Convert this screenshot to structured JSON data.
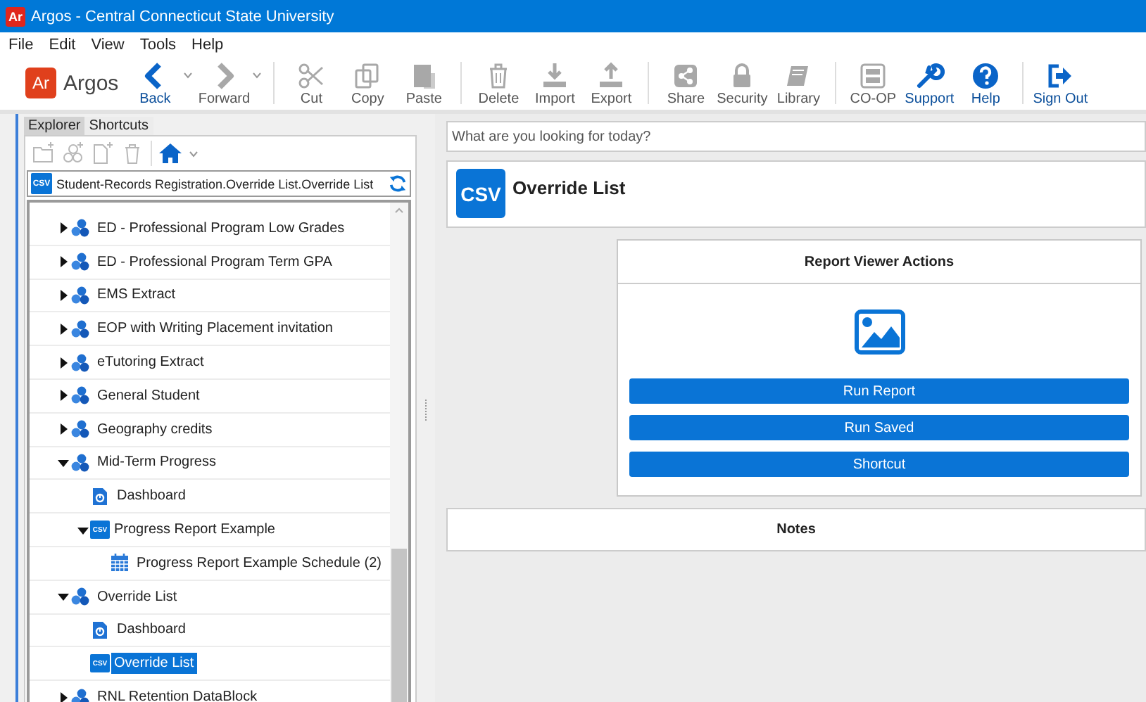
{
  "window": {
    "title": "Argos - Central Connecticut State University",
    "app_icon": "Ar"
  },
  "menu": [
    "File",
    "Edit",
    "View",
    "Tools",
    "Help"
  ],
  "toolbar": {
    "logo_badge": "Ar",
    "logo_text": "Argos",
    "groups": [
      [
        {
          "label": "Back",
          "disabled": false,
          "has_menu": true
        },
        {
          "label": "Forward",
          "disabled": true,
          "has_menu": true
        }
      ],
      [
        {
          "label": "Cut",
          "disabled": true,
          "has_menu": false
        },
        {
          "label": "Copy",
          "disabled": true,
          "has_menu": false
        },
        {
          "label": "Paste",
          "disabled": true,
          "has_menu": false
        }
      ],
      [
        {
          "label": "Delete",
          "disabled": true,
          "has_menu": false
        },
        {
          "label": "Import",
          "disabled": true,
          "has_menu": false
        },
        {
          "label": "Export",
          "disabled": true,
          "has_menu": false
        }
      ],
      [
        {
          "label": "Share",
          "disabled": true,
          "has_menu": false
        },
        {
          "label": "Security",
          "disabled": true,
          "has_menu": false
        },
        {
          "label": "Library",
          "disabled": true,
          "has_menu": false
        }
      ],
      [
        {
          "label": "CO-OP",
          "disabled": true,
          "has_menu": false
        },
        {
          "label": "Support",
          "disabled": false,
          "has_menu": false
        },
        {
          "label": "Help",
          "disabled": false,
          "has_menu": false
        }
      ],
      [
        {
          "label": "Sign Out",
          "disabled": false,
          "has_menu": false
        }
      ]
    ]
  },
  "explorer": {
    "tabs": [
      {
        "label": "Explorer",
        "selected": true
      },
      {
        "label": "Shortcuts",
        "selected": false
      }
    ],
    "tools": [
      {
        "disabled": true
      },
      {
        "disabled": true
      },
      {
        "disabled": true
      },
      {
        "disabled": true
      },
      {
        "disabled": false
      }
    ],
    "path": {
      "badge": "CSV",
      "text": "Student-Records Registration.Override List.Override List"
    },
    "tree": [
      {
        "label": "ED - Professional Program Low Grades",
        "kind": "datablock",
        "expanded": false,
        "selected": false
      },
      {
        "label": "ED - Professional Program Term GPA",
        "kind": "datablock",
        "expanded": false,
        "selected": false
      },
      {
        "label": "EMS Extract",
        "kind": "datablock",
        "expanded": false,
        "selected": false
      },
      {
        "label": "EOP with Writing Placement invitation",
        "kind": "datablock",
        "expanded": false,
        "selected": false
      },
      {
        "label": "eTutoring Extract",
        "kind": "datablock",
        "expanded": false,
        "selected": false
      },
      {
        "label": "General Student",
        "kind": "datablock",
        "expanded": false,
        "selected": false
      },
      {
        "label": "Geography credits",
        "kind": "datablock",
        "expanded": false,
        "selected": false
      },
      {
        "label": "Mid-Term Progress",
        "kind": "datablock",
        "expanded": true,
        "selected": false,
        "children": [
          {
            "label": "Dashboard",
            "kind": "dashboard",
            "selected": false
          },
          {
            "label": "Progress Report Example",
            "kind": "csv",
            "badge": "CSV",
            "expanded": true,
            "selected": false,
            "children": [
              {
                "label": "Progress Report Example Schedule (2)",
                "kind": "schedule",
                "selected": false
              }
            ]
          }
        ]
      },
      {
        "label": "Override List",
        "kind": "datablock",
        "expanded": true,
        "selected": false,
        "children": [
          {
            "label": "Dashboard",
            "kind": "dashboard",
            "selected": false
          },
          {
            "label": "Override List",
            "kind": "csv",
            "badge": "CSV",
            "selected": true
          }
        ]
      },
      {
        "label": "RNL Retention DataBlock",
        "kind": "datablock",
        "expanded": false,
        "selected": false
      }
    ]
  },
  "search": {
    "placeholder": "What are you looking for today?"
  },
  "report": {
    "badge": "CSV",
    "title": "Override List"
  },
  "actions": {
    "title": "Report Viewer Actions",
    "buttons": [
      "Run Report",
      "Run Saved",
      "Shortcut"
    ]
  },
  "notes": {
    "title": "Notes"
  }
}
